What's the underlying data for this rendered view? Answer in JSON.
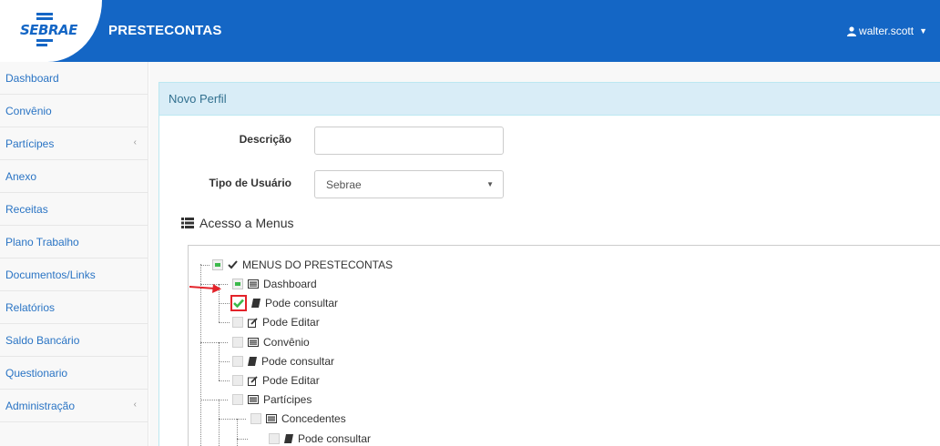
{
  "brand": {
    "logo_text": "SEBRAE",
    "app_title": "PRESTECONTAS",
    "colors": {
      "primary": "#1466c5",
      "link": "#2a74c4",
      "panel_heading_bg": "#d9edf7",
      "check_green": "#3cb94b",
      "highlight_red": "#e3232a"
    }
  },
  "user": {
    "name": "walter.scott",
    "icon": "user-icon"
  },
  "sidebar": {
    "items": [
      {
        "label": "Dashboard",
        "has_submenu": false
      },
      {
        "label": "Convênio",
        "has_submenu": false
      },
      {
        "label": "Partícipes",
        "has_submenu": true
      },
      {
        "label": "Anexo",
        "has_submenu": false
      },
      {
        "label": "Receitas",
        "has_submenu": false
      },
      {
        "label": "Plano Trabalho",
        "has_submenu": false
      },
      {
        "label": "Documentos/Links",
        "has_submenu": false
      },
      {
        "label": "Relatórios",
        "has_submenu": false
      },
      {
        "label": "Saldo Bancário",
        "has_submenu": false
      },
      {
        "label": "Questionario",
        "has_submenu": false
      },
      {
        "label": "Administração",
        "has_submenu": true
      }
    ]
  },
  "panel": {
    "title": "Novo Perfil"
  },
  "form": {
    "descricao_label": "Descrição",
    "descricao_value": "",
    "tipo_label": "Tipo de Usuário",
    "tipo_value": "Sebrae"
  },
  "access": {
    "title": "Acesso a Menus",
    "icon": "list-icon"
  },
  "tree": {
    "root": {
      "label": "MENUS DO PRESTECONTAS",
      "state": "partial"
    },
    "nodes": [
      {
        "label": "Dashboard",
        "state": "partial"
      },
      {
        "label": "Pode consultar",
        "state": "checked"
      },
      {
        "label": "Pode Editar",
        "state": "unchecked"
      },
      {
        "label": "Convênio",
        "state": "unchecked"
      },
      {
        "label": "Pode consultar",
        "state": "unchecked"
      },
      {
        "label": "Pode Editar",
        "state": "unchecked"
      },
      {
        "label": "Partícipes",
        "state": "unchecked"
      },
      {
        "label": "Concedentes",
        "state": "unchecked"
      },
      {
        "label": "Pode consultar",
        "state": "unchecked"
      }
    ]
  }
}
